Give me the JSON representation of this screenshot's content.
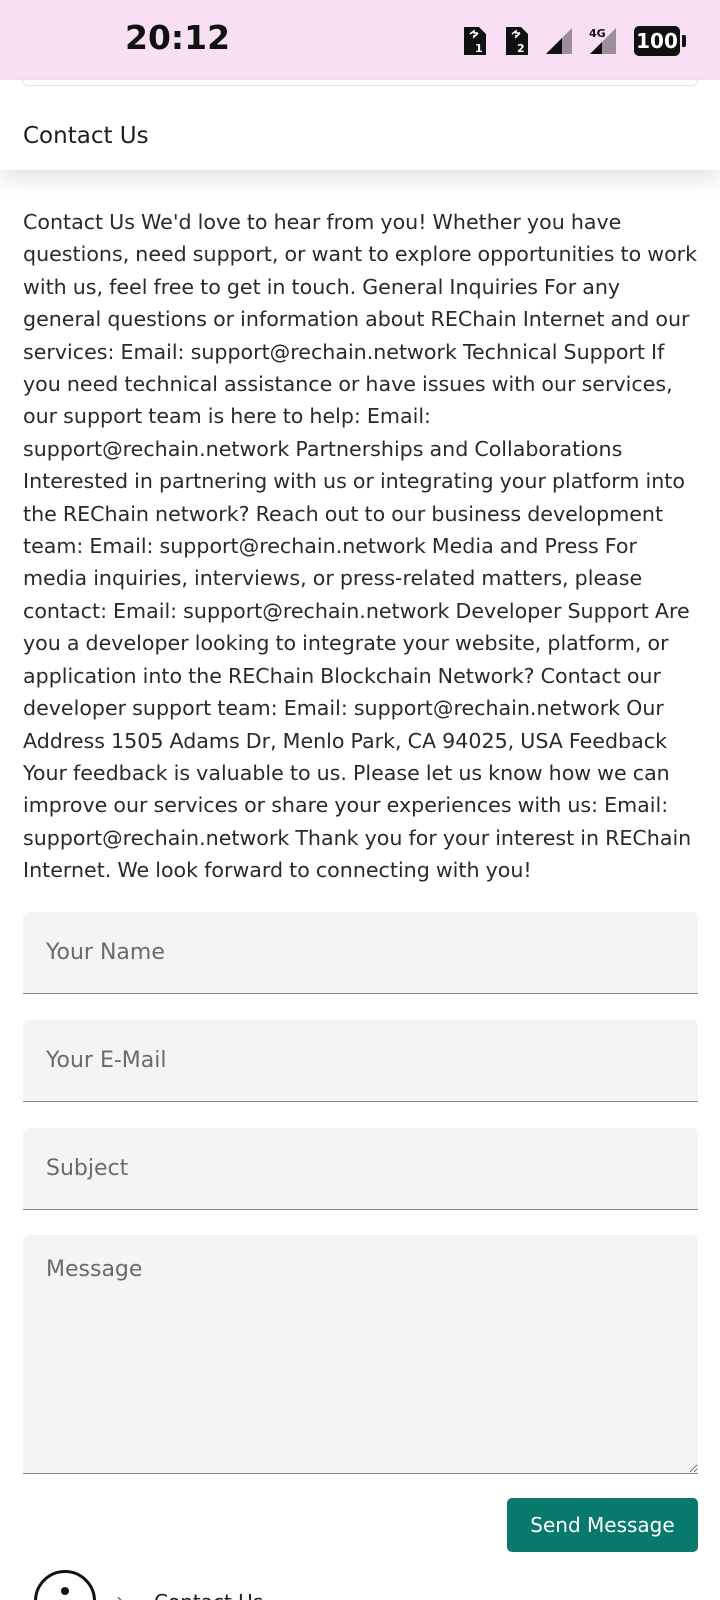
{
  "status_bar": {
    "time": "20:12",
    "network": "4G",
    "battery": "100",
    "icons": [
      "sim1-icon",
      "sim2-icon",
      "signal-icon",
      "signal-4g-icon",
      "battery-icon"
    ]
  },
  "header": {
    "title": "Contact Us"
  },
  "content": {
    "body": "Contact Us We'd love to hear from you! Whether you have questions, need support, or want to explore opportunities to work with us, feel free to get in touch. General Inquiries For any general questions or information about REChain Internet and our services: Email: support@rechain.network Technical Support If you need technical assistance or have issues with our services, our support team is here to help: Email: support@rechain.network Partnerships and Collaborations Interested in partnering with us or integrating your platform into the REChain network? Reach out to our business development team: Email: support@rechain.network Media and Press For media inquiries, interviews, or press-related matters, please contact: Email: support@rechain.network Developer Support Are you a developer looking to integrate your website, platform, or application into the REChain Blockchain Network? Contact our developer support team: Email: support@rechain.network Our Address 1505 Adams Dr, Menlo Park, CA 94025, USA Feedback Your feedback is valuable to us. Please let us know how we can improve our services or share your experiences with us: Email: support@rechain.network Thank you for your interest in REChain Internet. We look forward to connecting with you!"
  },
  "form": {
    "name_placeholder": "Your Name",
    "email_placeholder": "Your E-Mail",
    "subject_placeholder": "Subject",
    "message_placeholder": "Message",
    "name_value": "",
    "email_value": "",
    "subject_value": "",
    "message_value": "",
    "submit_label": "Send Message"
  },
  "breadcrumb": {
    "home_icon": "logo-icon",
    "separator": "›",
    "current": "Contact Us"
  },
  "colors": {
    "status_bar_bg": "#f9dff3",
    "accent": "#087a6b",
    "field_bg": "#f4f4f4"
  }
}
